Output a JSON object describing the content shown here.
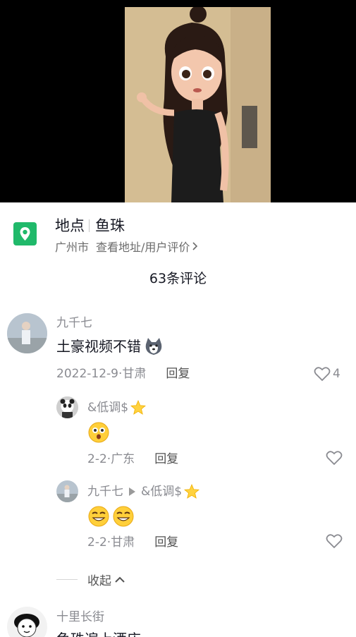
{
  "video": {
    "bg_color": "#000000"
  },
  "location": {
    "label": "地点",
    "name": "鱼珠",
    "city": "广州市",
    "link": "查看地址/用户评价",
    "icon": "location-pin-icon",
    "icon_color": "#20b96a"
  },
  "comment_count": "63条评论",
  "comments": [
    {
      "user": "九千七",
      "text": "土豪视频不错",
      "date": "2022-12-9",
      "region": "甘肃",
      "reply_label": "回复",
      "likes": "4",
      "replies": [
        {
          "user": "&低调$",
          "date": "2-2",
          "region": "广东",
          "reply_label": "回复"
        },
        {
          "user": "九千七",
          "reply_to": "&低调$",
          "date": "2-2",
          "region": "甘肃",
          "reply_label": "回复"
        }
      ],
      "collapse_label": "收起"
    },
    {
      "user": "十里长街",
      "text": "鱼珠遍上酒店"
    }
  ]
}
